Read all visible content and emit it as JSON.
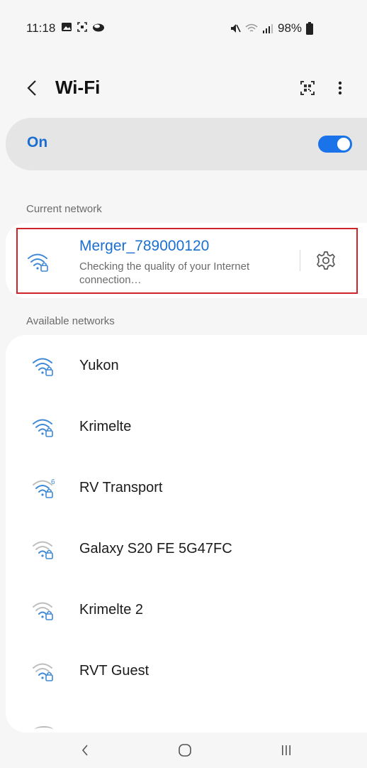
{
  "status_bar": {
    "time": "11:18",
    "battery": "98%",
    "left_icons": [
      "gallery-icon",
      "screenshot-icon",
      "cloud-icon"
    ],
    "right_icons": [
      "mute-icon",
      "wifi-status-icon",
      "signal-icon",
      "battery-icon"
    ]
  },
  "header": {
    "back_icon": "chevron-left-icon",
    "title": "Wi-Fi",
    "qr_icon": "qr-code-icon",
    "more_icon": "more-vertical-icon"
  },
  "wifi_toggle": {
    "label": "On",
    "enabled": true,
    "accent": "#1a73e8"
  },
  "current_network": {
    "section_label": "Current network",
    "name": "Merger_789000120",
    "status": "Checking the quality of your Internet connection…",
    "settings_icon": "gear-icon",
    "highlight_color": "#d0242b"
  },
  "available_networks": {
    "section_label": "Available networks",
    "items": [
      {
        "name": "Yukon",
        "signal": "strong",
        "secured": true,
        "wifi6": false
      },
      {
        "name": "Krimelte",
        "signal": "strong",
        "secured": true,
        "wifi6": false
      },
      {
        "name": "RV Transport",
        "signal": "medium",
        "secured": true,
        "wifi6": true
      },
      {
        "name": "Galaxy S20 FE 5G47FC",
        "signal": "weak",
        "secured": true,
        "wifi6": false
      },
      {
        "name": "Krimelte 2",
        "signal": "weak",
        "secured": true,
        "wifi6": false
      },
      {
        "name": "RVT Guest",
        "signal": "weak",
        "secured": true,
        "wifi6": false
      }
    ]
  },
  "nav_bar": {
    "back_icon": "nav-back-icon",
    "home_icon": "nav-home-icon",
    "recents_icon": "nav-recents-icon"
  }
}
